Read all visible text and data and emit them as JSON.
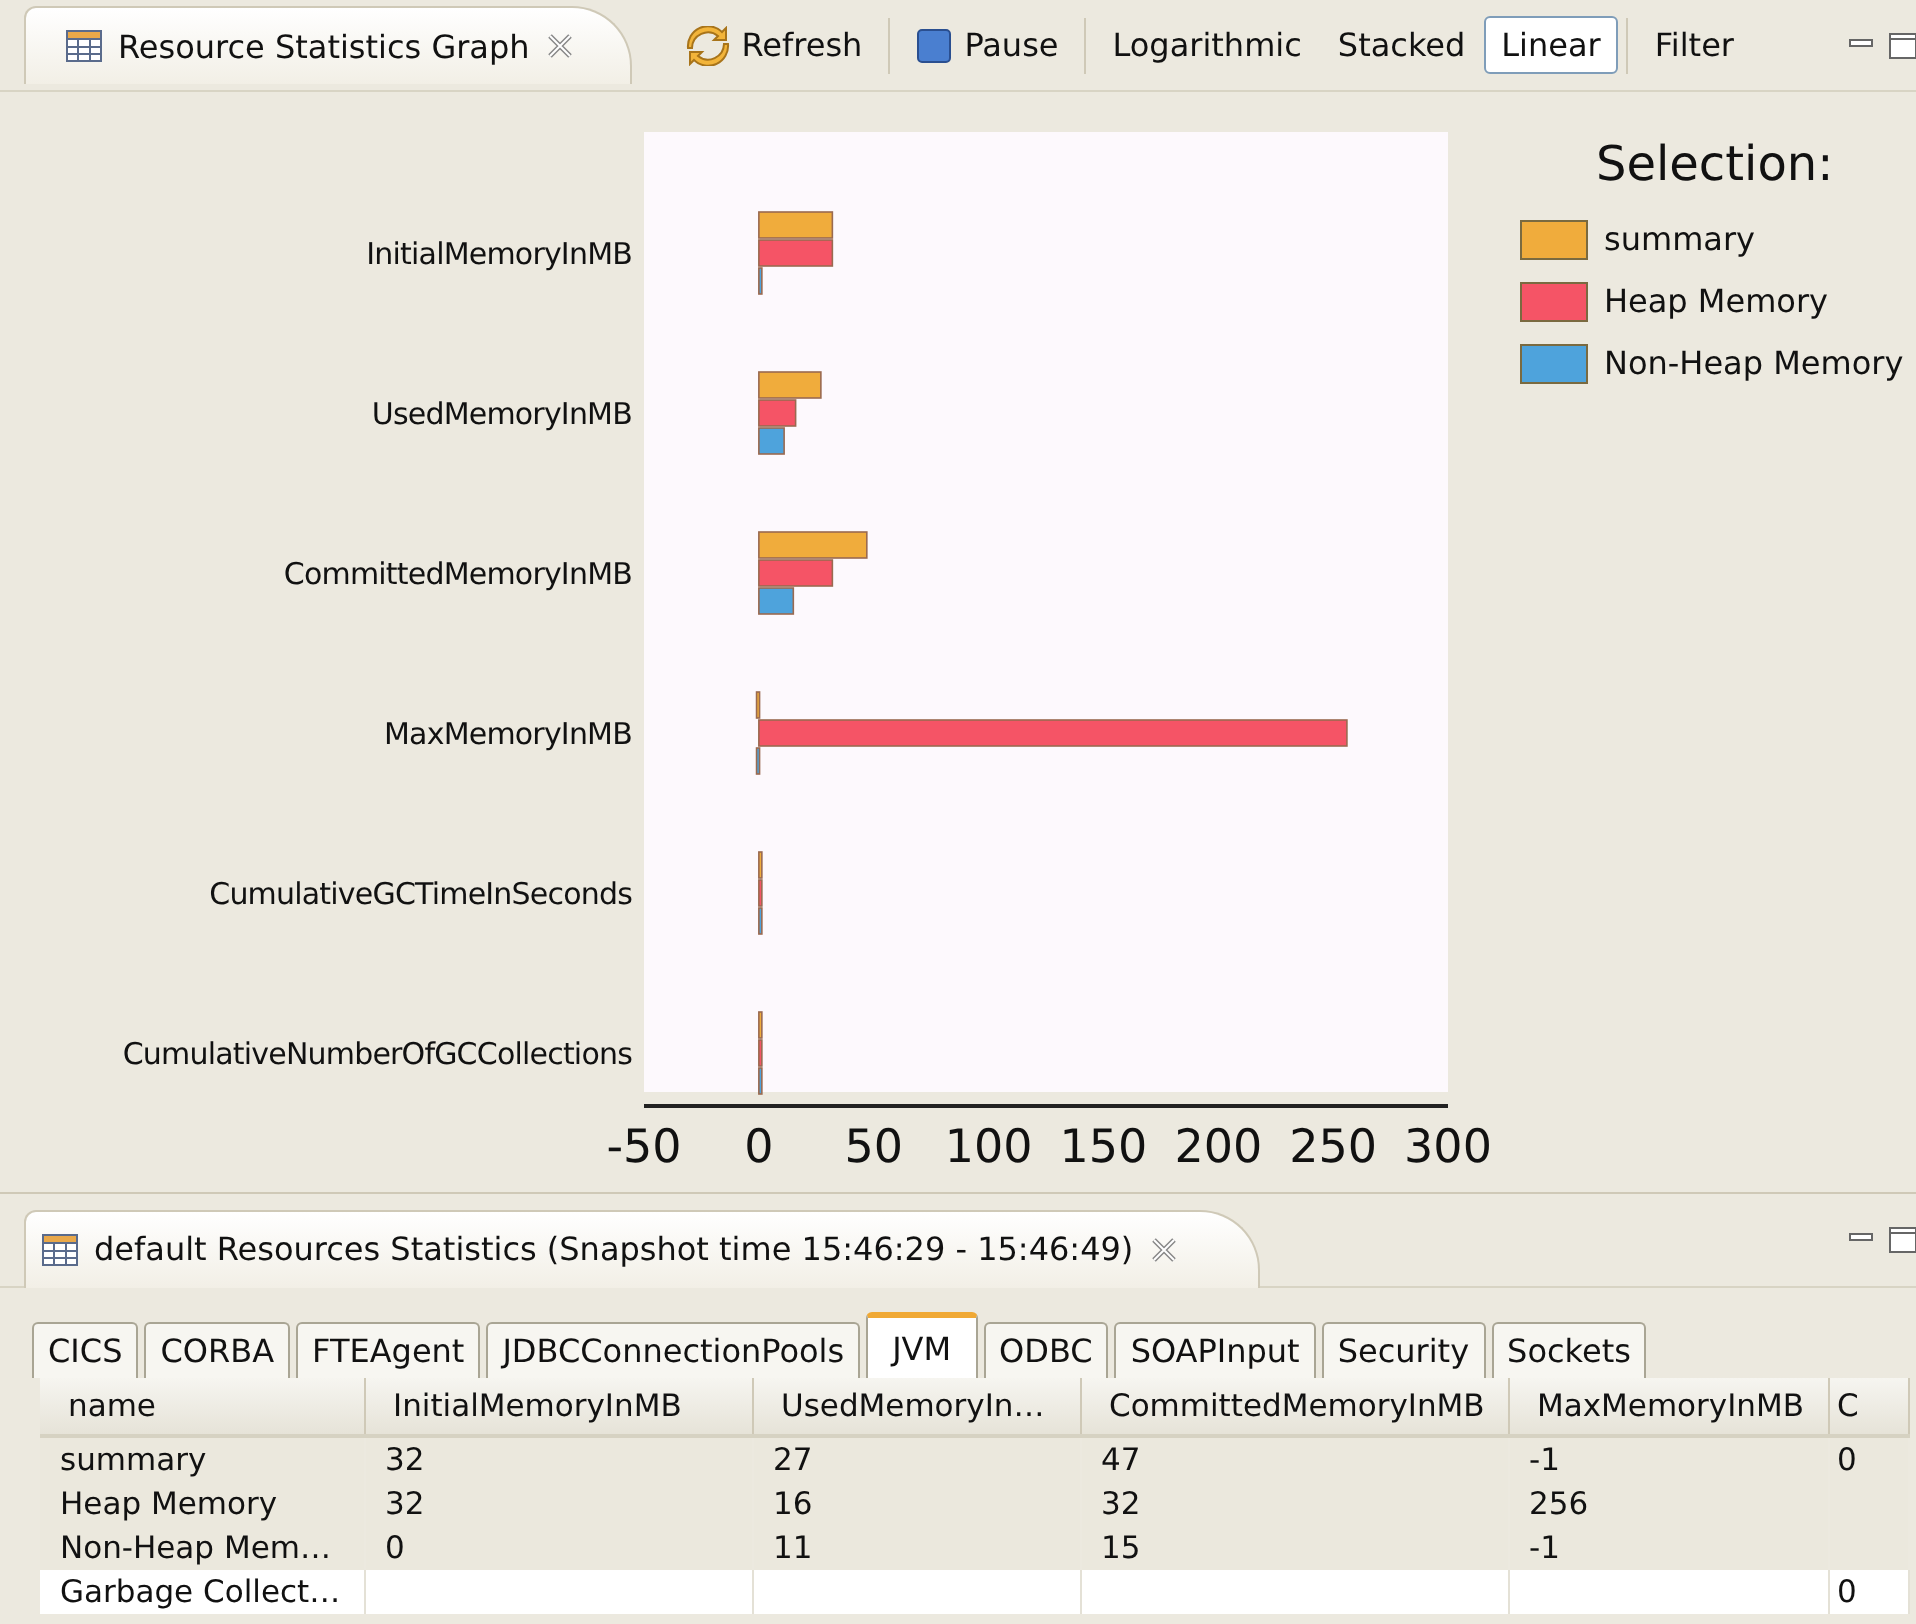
{
  "graph_view": {
    "title": "Resource Statistics Graph",
    "toolbar": [
      {
        "label": "Refresh",
        "kind": "refresh",
        "selected": false
      },
      {
        "label": "Pause",
        "kind": "pause",
        "selected": false
      },
      {
        "label": "Logarithmic",
        "kind": "text",
        "selected": false
      },
      {
        "label": "Stacked",
        "kind": "text",
        "selected": false
      },
      {
        "label": "Linear",
        "kind": "text",
        "selected": true
      },
      {
        "label": "Filter",
        "kind": "text",
        "selected": false
      }
    ],
    "chart_data": {
      "type": "bar",
      "orientation": "horizontal",
      "title": "Selection:",
      "categories": [
        "InitialMemoryInMB",
        "UsedMemoryInMB",
        "CommittedMemoryInMB",
        "MaxMemoryInMB",
        "CumulativeGCTimeInSeconds",
        "CumulativeNumberOfGCCollections"
      ],
      "series": [
        {
          "name": "summary",
          "color": "#f0ac3c",
          "values": [
            32,
            27,
            47,
            -1,
            0,
            0
          ]
        },
        {
          "name": "Heap Memory",
          "color": "#f55466",
          "values": [
            32,
            16,
            32,
            256,
            0,
            0
          ]
        },
        {
          "name": "Non-Heap Memory",
          "color": "#4ea3dc",
          "values": [
            0,
            11,
            15,
            -1,
            0,
            0
          ]
        }
      ],
      "xlim": [
        -50,
        300
      ],
      "xticks": [
        -50,
        0,
        50,
        100,
        150,
        200,
        250,
        300
      ]
    }
  },
  "stats_view": {
    "title": "default Resources Statistics (Snapshot time 15:46:29 - 15:46:49)",
    "tabs": [
      {
        "label": "CICS",
        "selected": false
      },
      {
        "label": "CORBA",
        "selected": false
      },
      {
        "label": "FTEAgent",
        "selected": false
      },
      {
        "label": "JDBCConnectionPools",
        "selected": false
      },
      {
        "label": "JVM",
        "selected": true
      },
      {
        "label": "ODBC",
        "selected": false
      },
      {
        "label": "SOAPInput",
        "selected": false
      },
      {
        "label": "Security",
        "selected": false
      },
      {
        "label": "Sockets",
        "selected": false
      }
    ],
    "table": {
      "columns": [
        "name",
        "InitialMemoryInMB",
        "UsedMemoryIn…",
        "CommittedMemoryInMB",
        "MaxMemoryInMB",
        "C"
      ],
      "rows": [
        {
          "selected": true,
          "cells": [
            "summary",
            "32",
            "27",
            "47",
            "-1",
            "0"
          ]
        },
        {
          "selected": true,
          "cells": [
            "Heap Memory",
            "32",
            "16",
            "32",
            "256",
            ""
          ]
        },
        {
          "selected": true,
          "cells": [
            "Non-Heap Mem…",
            "0",
            "11",
            "15",
            "-1",
            ""
          ]
        },
        {
          "selected": false,
          "cells": [
            "Garbage Collect…",
            "",
            "",
            "",
            "",
            "0"
          ]
        }
      ]
    }
  }
}
